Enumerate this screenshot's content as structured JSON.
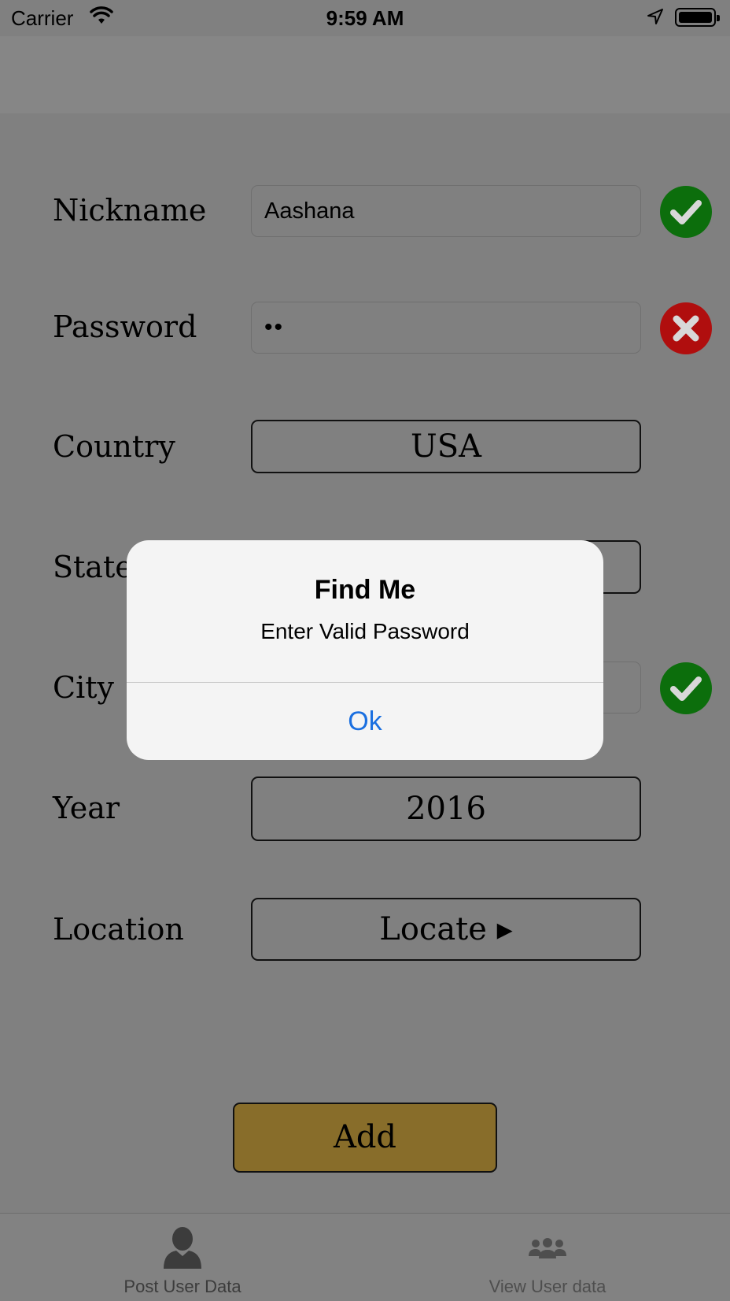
{
  "status_bar": {
    "carrier": "Carrier",
    "time": "9:59 AM"
  },
  "form": {
    "nickname": {
      "label": "Nickname",
      "value": "Aashana",
      "status": "valid"
    },
    "password": {
      "label": "Password",
      "value": "••",
      "status": "invalid"
    },
    "country": {
      "label": "Country",
      "value": "USA"
    },
    "state": {
      "label": "State"
    },
    "city": {
      "label": "City",
      "status": "valid"
    },
    "year": {
      "label": "Year",
      "value": "2016"
    },
    "location": {
      "label": "Location",
      "button_label": "Locate ▸"
    },
    "add_label": "Add"
  },
  "alert": {
    "title": "Find Me",
    "message": "Enter Valid Password",
    "ok_label": "Ok"
  },
  "tab_bar": {
    "tabs": [
      {
        "label": "Post User Data",
        "icon": "user-icon"
      },
      {
        "label": "View User data",
        "icon": "users-icon"
      }
    ]
  },
  "colors": {
    "valid": "#0c6e0c",
    "invalid": "#b00e0e",
    "add_button": "#886d2a",
    "alert_button": "#1a6fe0"
  }
}
